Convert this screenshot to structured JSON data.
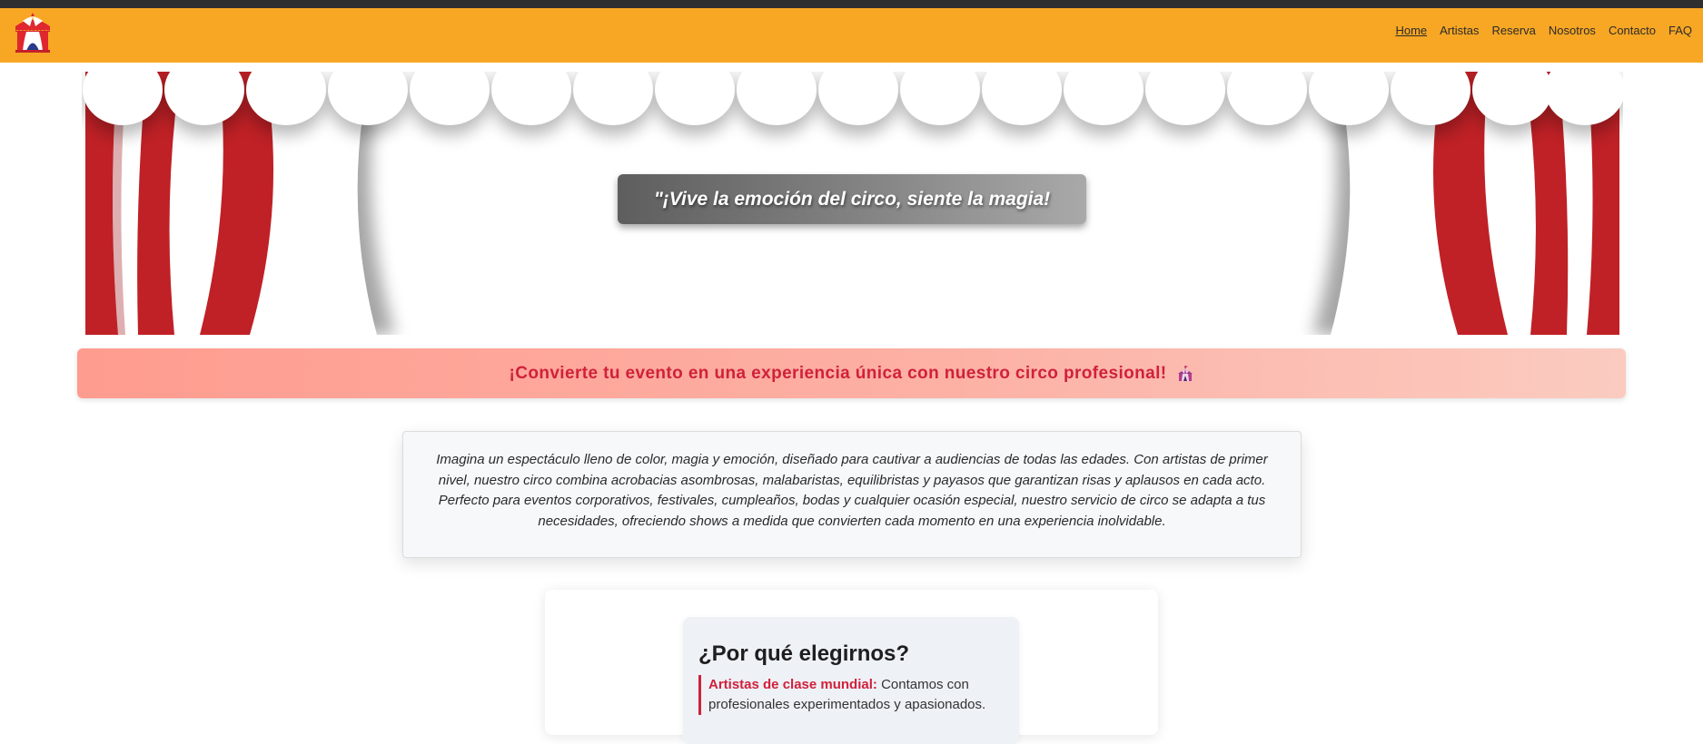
{
  "navbar": {
    "logo_icon": "circus-tent-logo-icon",
    "links": [
      {
        "label": "Home",
        "active": true
      },
      {
        "label": "Artistas",
        "active": false
      },
      {
        "label": "Reserva",
        "active": false
      },
      {
        "label": "Nosotros",
        "active": false
      },
      {
        "label": "Contacto",
        "active": false
      },
      {
        "label": "FAQ",
        "active": false
      }
    ]
  },
  "hero": {
    "quote": "\"¡Vive la emoción del circo, siente la magia!"
  },
  "promo": {
    "text": "¡Convierte tu evento en una experiencia única con nuestro circo profesional!",
    "icon": "circus-tent-icon"
  },
  "description": {
    "text": "Imagina un espectáculo lleno de color, magia y emoción, diseñado para cautivar a audiencias de todas las edades. Con artistas de primer nivel, nuestro circo combina acrobacias asombrosas, malabaristas, equilibristas y payasos que garantizan risas y aplausos en cada acto. Perfecto para eventos corporativos, festivales, cumpleaños, bodas y cualquier ocasión especial, nuestro servicio de circo se adapta a tus necesidades, ofreciendo shows a medida que convierten cada momento en una experiencia inolvidable."
  },
  "why": {
    "title": "¿Por qué elegirnos?",
    "items": [
      {
        "label": "Artistas de clase mundial:",
        "text": "Contamos con profesionales experimentados y apasionados."
      }
    ]
  },
  "colors": {
    "navbar": "#f8a724",
    "curtain_red": "#bf2126",
    "accent_red": "#d0213b"
  }
}
